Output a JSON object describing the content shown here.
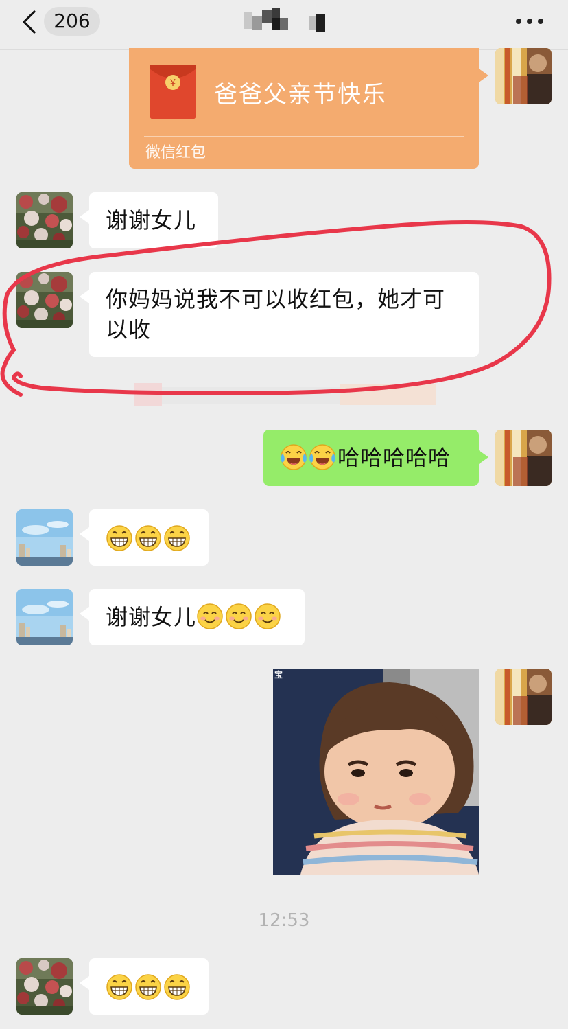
{
  "header": {
    "back_label": "<",
    "unread_count": "206"
  },
  "messages": {
    "red_packet": {
      "greeting": "爸爸父亲节快乐",
      "label": "微信红包",
      "icon_symbol": "¥"
    },
    "m1": {
      "text": "谢谢女儿"
    },
    "m2": {
      "text": "你妈妈说我不可以收红包，她才可以收"
    },
    "m3": {
      "emoji": [
        "face-with-tears-of-joy",
        "face-with-tears-of-joy"
      ],
      "text": "哈哈哈哈哈"
    },
    "m4": {
      "emoji": [
        "grinning-face",
        "grinning-face",
        "grinning-face"
      ]
    },
    "m5": {
      "text": "谢谢女儿",
      "emoji": [
        "smiling-face",
        "smiling-face",
        "smiling-face"
      ]
    },
    "m6": {
      "sticker_caption": "宝"
    },
    "timestamp": "12:53",
    "m7": {
      "emoji": [
        "grinning-face",
        "grinning-face",
        "grinning-face"
      ]
    }
  },
  "annotation": {
    "color": "#e8374a"
  },
  "colors": {
    "background": "#ededed",
    "sent_bubble": "#95ec69",
    "received_bubble": "#ffffff",
    "red_packet": "#f4ab6f"
  }
}
